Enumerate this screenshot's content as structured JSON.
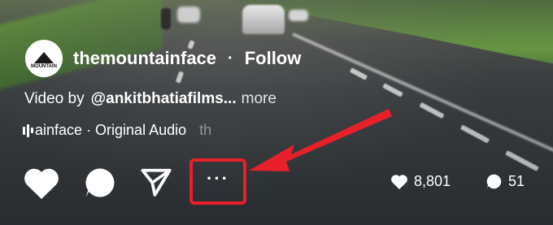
{
  "post": {
    "avatar_text": "MOUNTAIN",
    "username": "themountainface",
    "separator": "·",
    "follow_label": "Follow",
    "credit_prefix": "Video by",
    "credit_handle": "@ankitbhatiafilms...",
    "more_label": "more",
    "audio_text": "ainface · Original Audio",
    "audio_overflow": "th"
  },
  "actions": {
    "like_icon": "heart-icon",
    "comment_icon": "comment-icon",
    "share_icon": "send-icon",
    "more_icon": "more-options-icon",
    "more_glyph": "···"
  },
  "stats": {
    "likes": "8,801",
    "comments": "51"
  },
  "colors": {
    "highlight_box": "#e8202a",
    "arrow": "#e8202a",
    "text": "#ffffff"
  }
}
